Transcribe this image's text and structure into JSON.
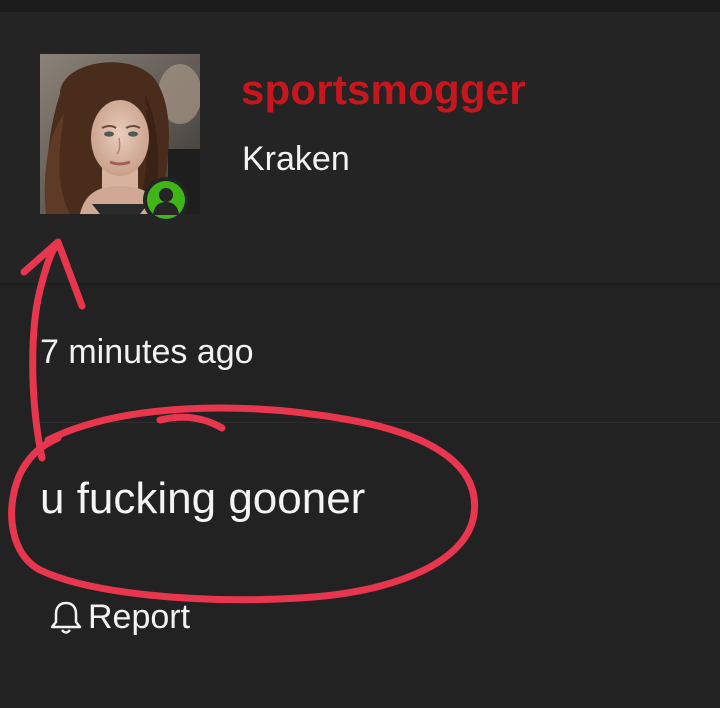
{
  "post": {
    "author": {
      "username": "sportsmogger",
      "user_title": "Kraken",
      "avatar_icon": "profile-photo",
      "status_icon": "online-user-icon",
      "status_color": "#3fb618",
      "username_color": "#c8161d"
    },
    "timestamp": "7 minutes ago",
    "message": "u fucking gooner",
    "actions": {
      "report_label": "Report",
      "report_icon": "bell-icon"
    }
  },
  "annotation": {
    "color": "#e8364f",
    "shapes": [
      "circle-around-message",
      "arrow-pointing-to-avatar"
    ]
  }
}
